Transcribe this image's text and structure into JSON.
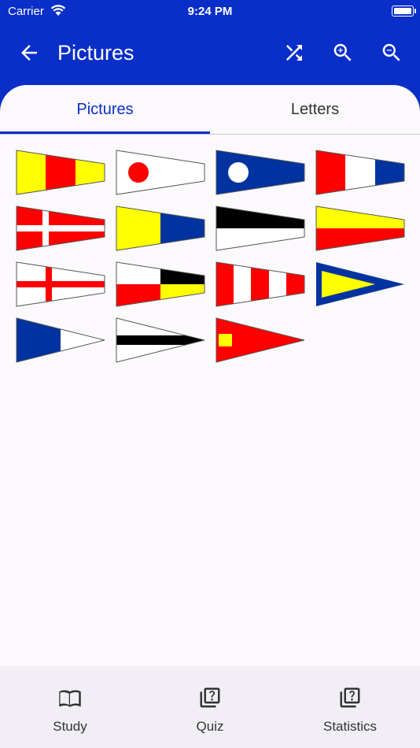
{
  "status_bar": {
    "carrier": "Carrier",
    "time": "9:24 PM"
  },
  "app_bar": {
    "title": "Pictures",
    "actions": [
      {
        "name": "shuffle-icon"
      },
      {
        "name": "zoom-in-icon"
      },
      {
        "name": "zoom-out-icon"
      }
    ]
  },
  "tabs": [
    {
      "label": "Pictures",
      "selected": true
    },
    {
      "label": "Letters",
      "selected": false
    }
  ],
  "flags": [
    "pennant-1",
    "pennant-2",
    "pennant-3",
    "pennant-4",
    "pennant-5",
    "pennant-6",
    "pennant-7",
    "pennant-8",
    "pennant-9",
    "pennant-0",
    "substitute-1",
    "substitute-2",
    "substitute-3"
  ],
  "bottom_nav": [
    {
      "label": "Study",
      "icon": "book-icon"
    },
    {
      "label": "Quiz",
      "icon": "quiz-icon"
    },
    {
      "label": "Statistics",
      "icon": "statistics-icon"
    }
  ],
  "colors": {
    "primary": "#0a2ec8",
    "red": "#ff0000",
    "yellow": "#ffff00",
    "blue": "#0033a0"
  }
}
